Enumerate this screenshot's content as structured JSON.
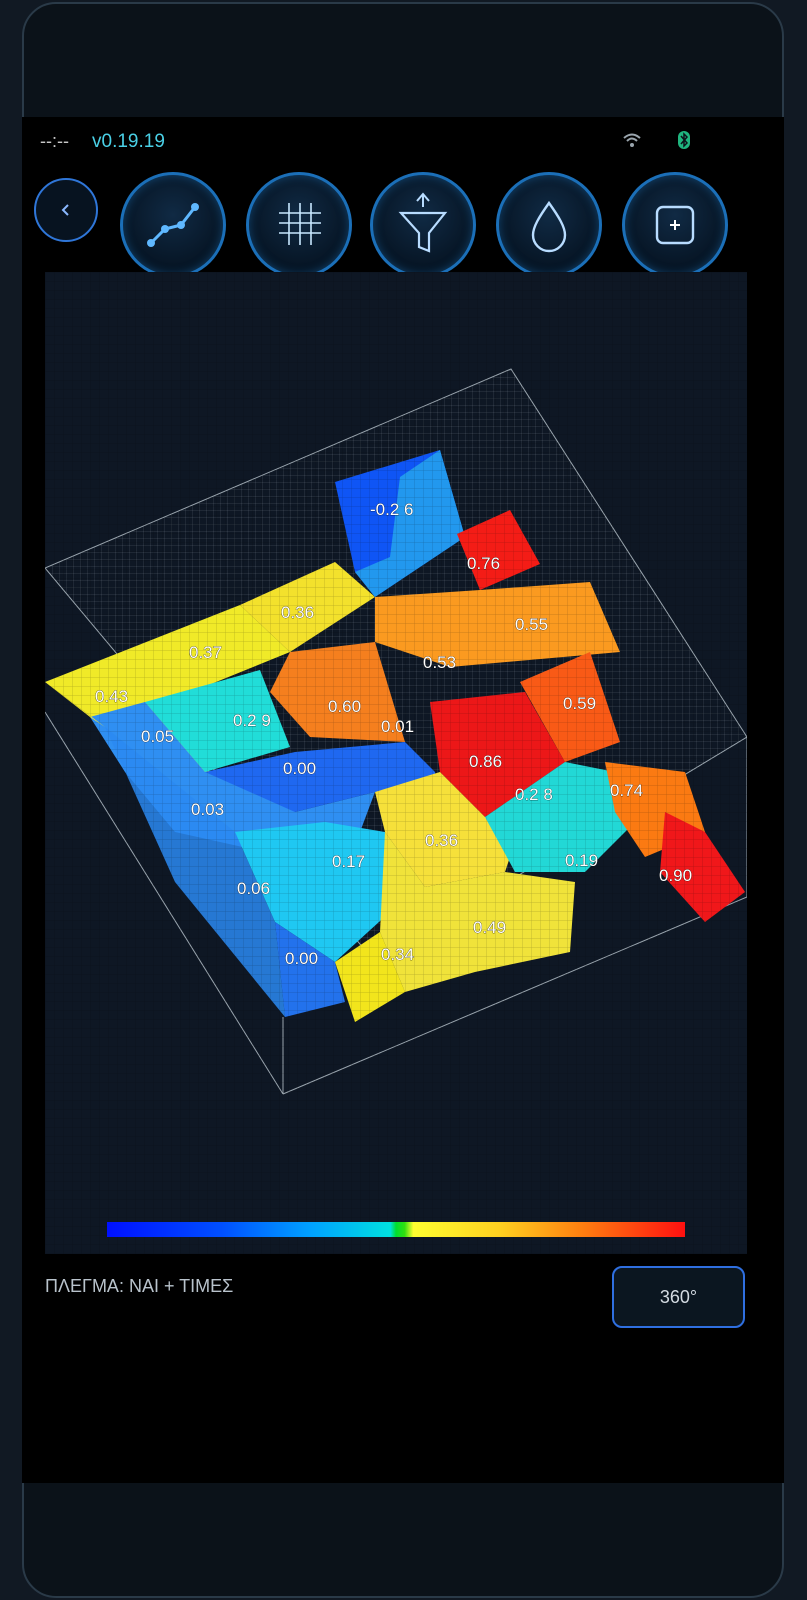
{
  "status": {
    "time": "--:--",
    "version": "v0.19.19"
  },
  "toolbar": {
    "back_icon": "chevron-left-icon",
    "buttons": [
      {
        "icon": "line-chart-icon"
      },
      {
        "icon": "grid-icon"
      },
      {
        "icon": "filter-icon"
      },
      {
        "icon": "drop-icon"
      },
      {
        "icon": "add-square-icon"
      }
    ]
  },
  "chart_data": {
    "type": "heatmap",
    "labels": [
      "-0.2 6",
      "0.76",
      "0.36",
      "0.55",
      "0.37",
      "0.53",
      "0.43",
      "0.2 9",
      "0.60",
      "0.59",
      "0.05",
      "0.01",
      "0.00",
      "0.86",
      "0.2 8",
      "0.74",
      "0.03",
      "0.36",
      "0.17",
      "0.19",
      "0.90",
      "0.06",
      "0.49",
      "0.00",
      "0.34"
    ]
  },
  "footer": {
    "mode_label": "ΠΛΕΓΜΑ: ΝΑΙ + ΤΙΜΕΣ",
    "rotate_label": "360°"
  }
}
